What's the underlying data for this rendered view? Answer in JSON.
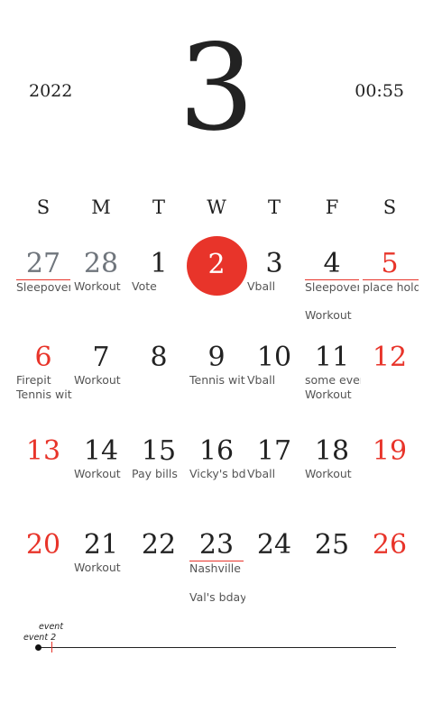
{
  "header": {
    "year": "2022",
    "month": "3",
    "time": "00:55"
  },
  "weekdays": [
    "S",
    "M",
    "T",
    "W",
    "T",
    "F",
    "S"
  ],
  "weeks": [
    [
      "27",
      "28",
      "1",
      "2",
      "3",
      "4",
      "5"
    ],
    [
      "6",
      "7",
      "8",
      "9",
      "10",
      "11",
      "12"
    ],
    [
      "13",
      "14",
      "15",
      "16",
      "17",
      "18",
      "19"
    ],
    [
      "20",
      "21",
      "22",
      "23",
      "24",
      "25",
      "26"
    ]
  ],
  "today": "2",
  "events": {
    "w1_sun": "Sleepover",
    "w1_mon": "Workout",
    "w1_tue": "Vote",
    "w1_thu": "Vball",
    "w1_fri_1": "Sleepover",
    "w1_sat_1": "place holder",
    "w1_fri_2": "Workout",
    "w2_sun_1": "Firepit",
    "w2_sun_2": "Tennis with",
    "w2_mon": "Workout",
    "w2_wed": "Tennis with",
    "w2_thu": "Vball",
    "w2_fri_1": "some event",
    "w2_fri_2": "Workout",
    "w3_mon": "Workout",
    "w3_tue": "Pay bills",
    "w3_wed": "Vicky's bday",
    "w3_thu": "Vball",
    "w3_fri": "Workout",
    "w4_mon": "Workout",
    "w4_wed_1": "Nashville",
    "w4_wed_2": "Val's bday"
  },
  "timeline": {
    "label_top": "event",
    "label_bottom": "event 2"
  },
  "colors": {
    "accent": "#e8342a",
    "text": "#222222",
    "muted": "#6f757c",
    "event_text": "#555555"
  }
}
